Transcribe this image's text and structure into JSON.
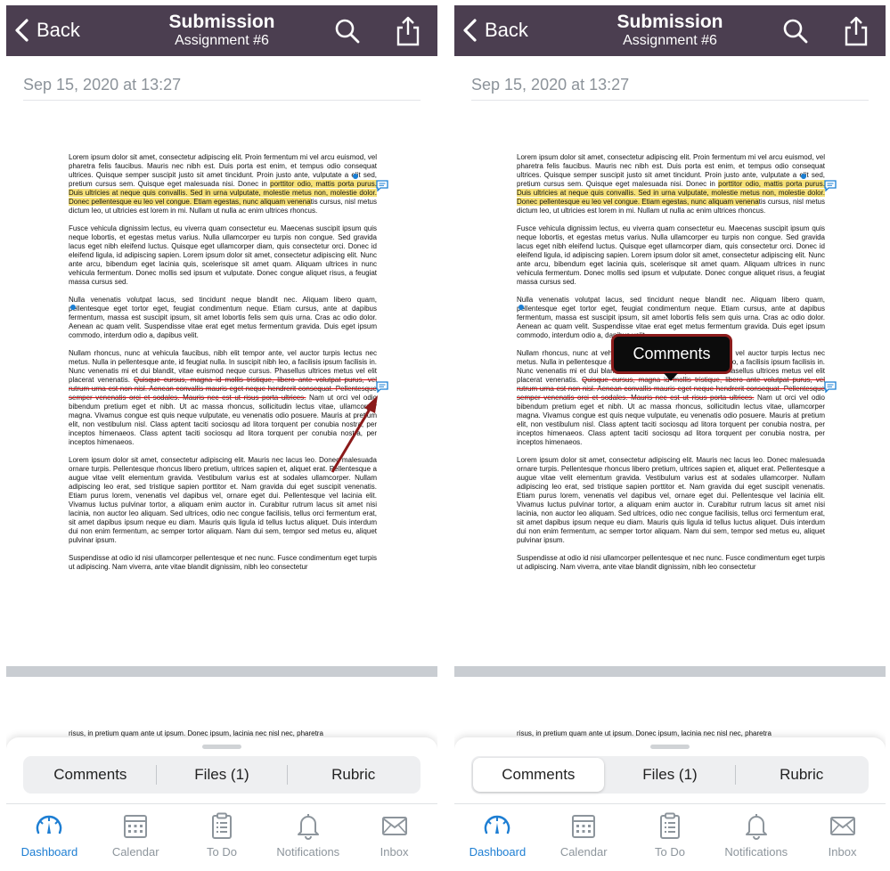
{
  "screens": [
    {
      "nav": {
        "back_label": "Back",
        "title": "Submission",
        "subtitle": "Assignment #6"
      },
      "date": "Sep 15, 2020 at 13:27",
      "segments": {
        "comments": "Comments",
        "files": "Files (1)",
        "rubric": "Rubric",
        "active": ""
      },
      "tabs": {
        "dashboard": "Dashboard",
        "calendar": "Calendar",
        "todo": "To Do",
        "notifications": "Notifications",
        "inbox": "Inbox"
      }
    },
    {
      "nav": {
        "back_label": "Back",
        "title": "Submission",
        "subtitle": "Assignment #6"
      },
      "date": "Sep 15, 2020 at 13:27",
      "segments": {
        "comments": "Comments",
        "files": "Files (1)",
        "rubric": "Rubric",
        "active": "comments"
      },
      "tabs": {
        "dashboard": "Dashboard",
        "calendar": "Calendar",
        "todo": "To Do",
        "notifications": "Notifications",
        "inbox": "Inbox"
      },
      "tooltip": "Comments"
    }
  ],
  "document": {
    "p1_before": "Lorem ipsum dolor sit amet, consectetur adipiscing elit. Proin fermentum mi vel arcu euismod, vel pharetra felis faucibus. Mauris nec nibh est. Duis porta est enim, et tempus odio consequat ultrices. Quisque semper suscipit justo sit amet tincidunt. Proin justo ante, vulputate a elit sed, pretium cursus sem. Quisque eget malesuada nisi. Donec in ",
    "p1_highlight": "porttitor odio, mattis porta purus. Duis ultricies at neque quis convallis. Sed in urna vulputate, molestie metus non, molestie dolor. Donec pellentesque eu leo vel congue. Etiam egestas, nunc aliquam venena",
    "p1_after": "tis cursus, nisl metus dictum leo, ut ultricies est lorem in mi. Nullam ut nulla ac enim ultrices rhoncus.",
    "p2": "Fusce vehicula dignissim lectus, eu viverra quam consectetur eu. Maecenas suscipit ipsum quis neque lobortis, et egestas metus varius. Nulla ullamcorper eu turpis non congue. Sed gravida lacus eget nibh eleifend luctus. Quisque eget ullamcorper diam, quis consectetur orci. Donec id eleifend ligula, id adipiscing sapien. Lorem ipsum dolor sit amet, consectetur adipiscing elit. Nunc ante arcu, bibendum eget lacinia quis, scelerisque sit amet quam. Aliquam ultrices in nunc vehicula fermentum. Donec mollis sed ipsum et vulputate. Donec congue aliquet risus, a feugiat massa cursus sed.",
    "p3": "Nulla venenatis volutpat lacus, sed tincidunt neque blandit nec. Aliquam libero quam, pellentesque eget tortor eget, feugiat condimentum neque. Etiam cursus, ante at dapibus fermentum, massa est suscipit ipsum, sit amet lobortis felis sem quis urna. Cras ac odio dolor. Aenean ac quam velit. Suspendisse vitae erat eget metus fermentum gravida. Duis eget ipsum commodo, interdum odio a, dapibus velit.",
    "p4_before": "Nullam rhoncus, nunc at vehicula faucibus, nibh elit tempor ante, vel auctor turpis lectus nec metus. Nulla in pellentesque ante, id feugiat nulla. In suscipit nibh leo, a facilisis ipsum facilisis in. Nunc venenatis mi et dui blandit, vitae euismod neque cursus. Phasellus ultrices metus vel elit placerat venenatis. ",
    "p4_strike": "Quisque cursus, magna id mollis tristique, libero ante volutpat purus, vel rutrum urna est non nisl. Aenean convallis mauris eget neque hendrerit consequat. Pellentesque semper venenatis orci et sodales. Mauris nec est ut risus porta ultrices.",
    "p4_after": " Nam ut orci vel odio bibendum pretium eget et nibh. Ut ac massa rhoncus, sollicitudin lectus vitae, ullamcorper magna. Vivamus congue est quis neque vulputate, eu venenatis odio posuere. Mauris at pretium elit, non vestibulum nisl. Class aptent taciti sociosqu ad litora torquent per conubia nostra, per inceptos himenaeos. Class aptent taciti sociosqu ad litora torquent per conubia nostra, per inceptos himenaeos.",
    "p5": "Lorem ipsum dolor sit amet, consectetur adipiscing elit. Mauris nec lacus leo. Donec malesuada ornare turpis. Pellentesque rhoncus libero pretium, ultrices sapien et, aliquet erat. Pellentesque a augue vitae velit elementum gravida. Vestibulum varius est at sodales ullamcorper. Nullam adipiscing leo erat, sed tristique sapien porttitor et. Nam gravida dui eget suscipit venenatis. Etiam purus lorem, venenatis vel dapibus vel, ornare eget dui. Pellentesque vel lacinia elit. Vivamus luctus pulvinar tortor, a aliquam enim auctor in. Curabitur rutrum lacus sit amet nisi lacinia, non auctor leo aliquam. Sed ultrices, odio nec congue facilisis, tellus orci fermentum erat, sit amet dapibus ipsum neque eu diam. Mauris quis ligula id tellus luctus aliquet. Duis interdum dui non enim fermentum, ac semper tortor aliquam. Nam dui sem, tempor sed metus eu, aliquet pulvinar ipsum.",
    "p6": "Suspendisse at odio id nisi ullamcorper pellentesque et nec nunc. Fusce condimentum eget turpis ut adipiscing. Nam viverra, ante vitae blandit dignissim, nibh leo consectetur",
    "peek": "risus, in pretium quam ante ut ipsum. Donec ipsum, lacinia nec nisl nec, pharetra"
  },
  "colors": {
    "nav_bg": "#4b3e50",
    "highlight": "#f7e27a",
    "strike": "#d11111",
    "annotation_blue": "#1a7fd4",
    "tab_active": "#1d7ed3",
    "tooltip_border": "#8c1c1c"
  }
}
